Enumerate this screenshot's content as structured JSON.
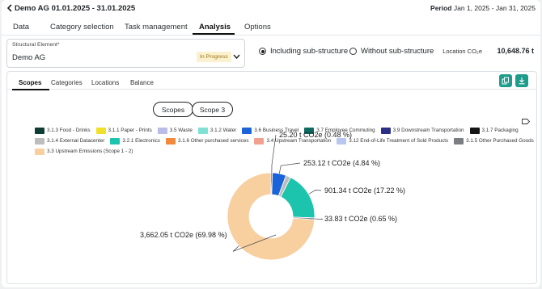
{
  "header": {
    "title": "Demo AG 01.01.2025 - 31.01.2025",
    "period_label": "Period",
    "period_value": "Jan 1, 2025 - Jan 31, 2025"
  },
  "tabs": [
    {
      "label": "Data"
    },
    {
      "label": "Category selection"
    },
    {
      "label": "Task management"
    },
    {
      "label": "Analysis",
      "active": true
    },
    {
      "label": "Options"
    }
  ],
  "structural": {
    "label": "Structural Element*",
    "value": "Demo AG",
    "status": "In Progress"
  },
  "radios": [
    {
      "label": "Including sub-structure",
      "selected": true
    },
    {
      "label": "Without sub-structure",
      "selected": false
    }
  ],
  "location": {
    "label": "Location CO₂e",
    "value": "10,648.76 t"
  },
  "subtabs": [
    {
      "label": "Scopes",
      "active": true
    },
    {
      "label": "Categories"
    },
    {
      "label": "Locations"
    },
    {
      "label": "Balance"
    }
  ],
  "toggle": {
    "scopes": "Scopes",
    "scope3": "Scope 3"
  },
  "legend": [
    {
      "label": "3.1.3 Food - Drinks",
      "color": "#0f3d36"
    },
    {
      "label": "3.1.1 Paper - Prints",
      "color": "#f1e02a"
    },
    {
      "label": "3.5 Waste",
      "color": "#b8bce6"
    },
    {
      "label": "3.1.2 Water",
      "color": "#7fe0d4"
    },
    {
      "label": "3.6 Business Travel",
      "color": "#1b63d8"
    },
    {
      "label": "3.7 Employee Commuting",
      "color": "#0e6b62"
    },
    {
      "label": "3.9 Downstream Transportation",
      "color": "#2b2f86"
    },
    {
      "label": "3.1.7 Packaging",
      "color": "#151515"
    },
    {
      "label": "3.1.4 External Datacenter",
      "color": "#bdbdbd"
    },
    {
      "label": "3.2.1 Electronics",
      "color": "#1cc4ae"
    },
    {
      "label": "3.1.6 Other purchased services",
      "color": "#f3893a"
    },
    {
      "label": "3.4 Upstream Transportation",
      "color": "#f2a090"
    },
    {
      "label": "3.12 End-of-Life Treatment of Sold Products",
      "color": "#b9c6f0"
    },
    {
      "label": "3.1.5 Other Purchased Goods",
      "color": "#7a7e82"
    },
    {
      "label": "3.3 Upstream Emissions (Scope 1 - 2)",
      "color": "#f8cf9f"
    }
  ],
  "chart_data": {
    "type": "pie",
    "donut": true,
    "unit": "t CO2e",
    "slices": [
      {
        "name": "3.1.3 Food - Drinks",
        "value": 25.2,
        "percent": 0.48,
        "color": "#0f3d36",
        "label": "25.20 t  CO2e (0.48 %)"
      },
      {
        "name": "3.6 Business Travel",
        "value": 253.12,
        "percent": 4.84,
        "color": "#1b63d8",
        "label": "253.12 t  CO2e (4.84 %)"
      },
      {
        "name": "3.1.4 External Datacenter",
        "value": 90.0,
        "percent": 1.72,
        "color": "#bdbdbd"
      },
      {
        "name": "3.2.1 Electronics",
        "value": 901.34,
        "percent": 17.22,
        "color": "#1cc4ae",
        "label": "901.34 t  CO2e (17.22 %)"
      },
      {
        "name": "3.1.5 Other Purchased Goods",
        "value": 33.83,
        "percent": 0.65,
        "color": "#7a7e82",
        "label": "33.83 t  CO2e (0.65 %)"
      },
      {
        "name": "3.3 Upstream Emissions (Scope 1 - 2)",
        "value": 3662.05,
        "percent": 69.98,
        "color": "#f8cf9f",
        "label": "3,662.05 t  CO2e (69.98 %)"
      }
    ]
  }
}
